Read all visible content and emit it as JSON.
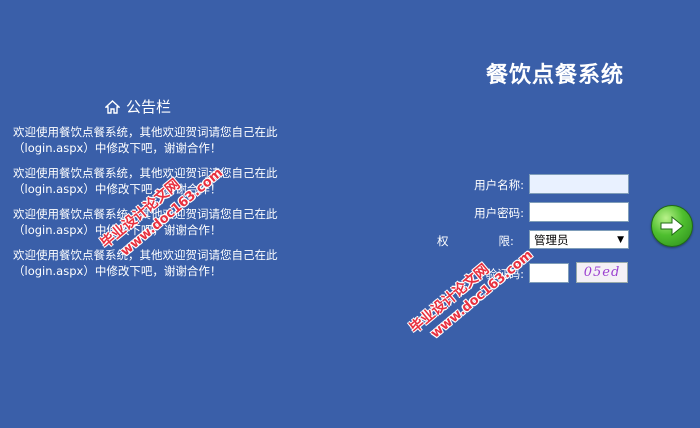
{
  "app": {
    "title": "餐饮点餐系统"
  },
  "notice": {
    "title": "公告栏",
    "items": [
      "欢迎使用餐饮点餐系统，其他欢迎贺词请您自己在此（login.aspx）中修改下吧，谢谢合作！",
      "欢迎使用餐饮点餐系统，其他欢迎贺词请您自己在此（login.aspx）中修改下吧，谢谢合作！",
      "欢迎使用餐饮点餐系统，其他欢迎贺词请您自己在此（login.aspx）中修改下吧，谢谢合作！",
      "欢迎使用餐饮点餐系统，其他欢迎贺词请您自己在此（login.aspx）中修改下吧，谢谢合作！"
    ]
  },
  "login": {
    "username_label": "用户名称:",
    "password_label": "用户密码:",
    "role_label_1": "权",
    "role_label_2": "限:",
    "role_value": "管理员",
    "code_label": "验证码:",
    "captcha_text": "05ed",
    "username_value": "",
    "password_value": "",
    "code_value": ""
  },
  "watermark": {
    "line1": "毕业设计论文网",
    "line2": "www.doc163.com"
  },
  "colors": {
    "background": "#3a5fa9",
    "watermark": "#e8303f",
    "go_button": "#4fbf2f"
  },
  "icons": {
    "notice": "home-icon",
    "submit": "arrow-right-icon"
  }
}
